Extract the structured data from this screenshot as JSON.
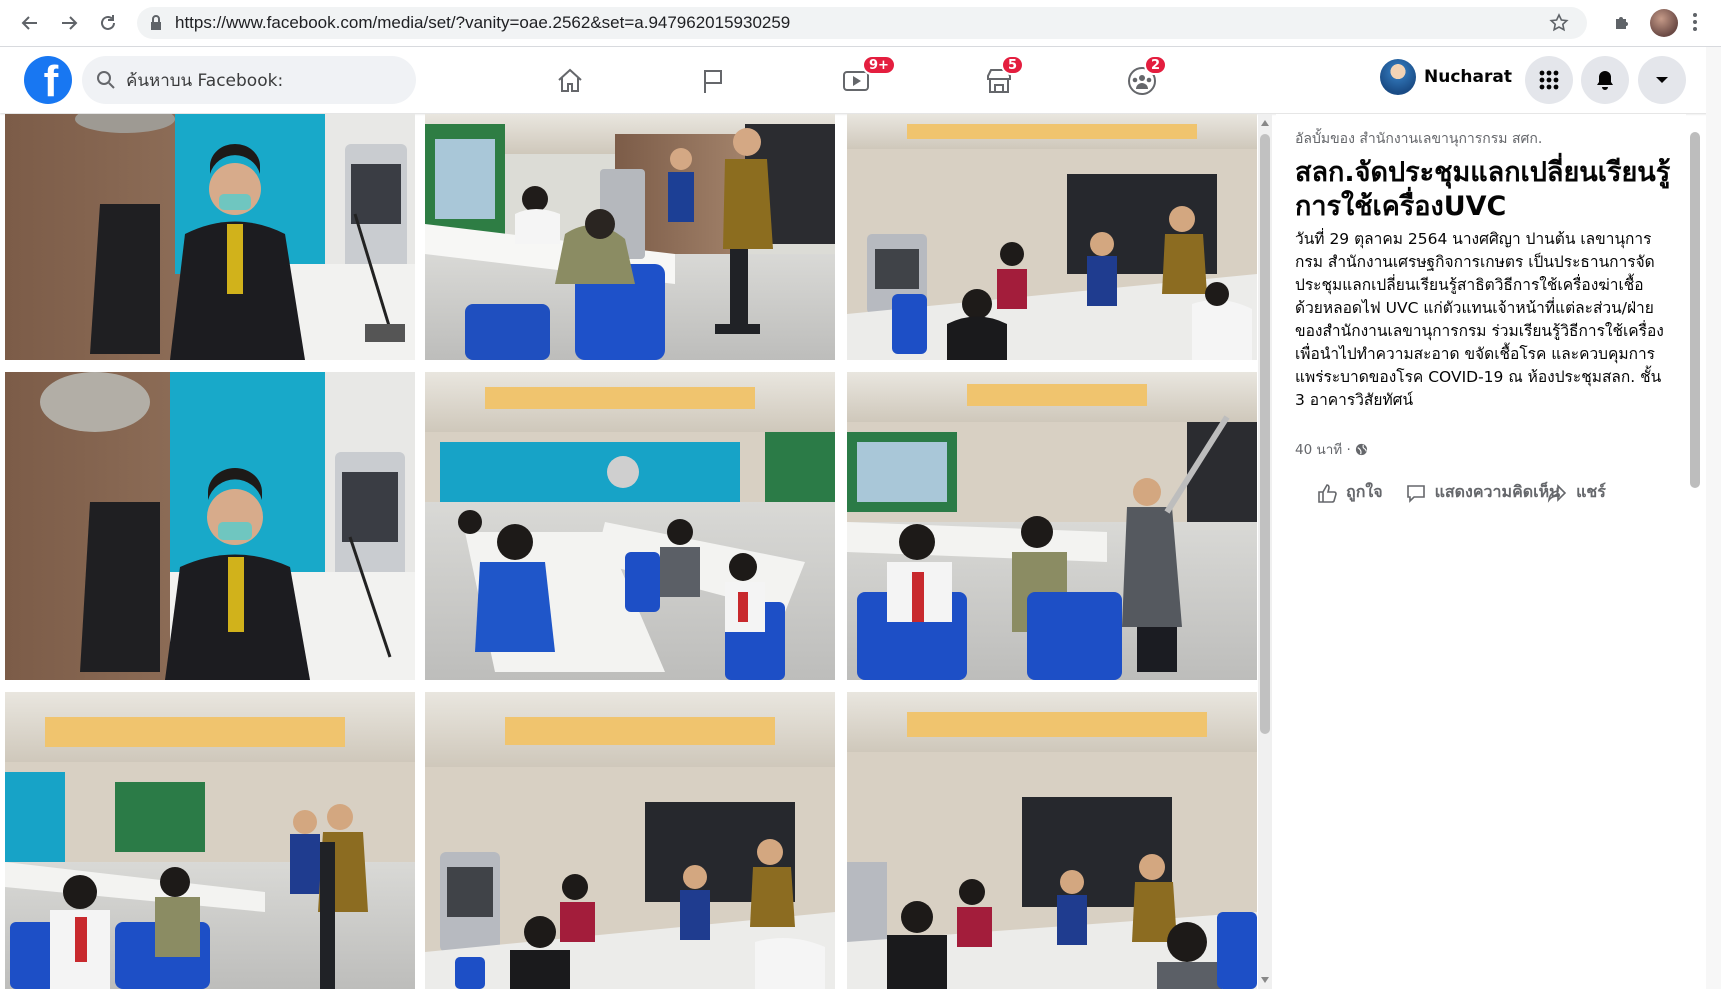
{
  "browser": {
    "url": "https://www.facebook.com/media/set/?vanity=oae.2562&set=a.947962015930259"
  },
  "header": {
    "search_placeholder": "ค้นหาบน Facebook:",
    "badges": {
      "watch": "9+",
      "marketplace": "5",
      "groups": "2"
    },
    "user_name": "Nucharat",
    "brand_color": "#1877f2",
    "badge_color": "#e41e3f"
  },
  "post": {
    "album_owner": "อัลบั้มของ สำนักงานเลขานุการกรม สศก.",
    "title": "สลก.จัดประชุมแลกเปลี่ยนเรียนรู้การใช้เครื่องUVC",
    "body": "วันที่ 29 ตุลาคม 2564 นางศศิญา ปานต้น เลขานุการกรม สำนักงานเศรษฐกิจการเกษตร เป็นประธานการจัดประชุมแลกเปลี่ยนเรียนรู้สาธิตวิธีการใช้เครื่องฆ่าเชื้อด้วยหลอดไฟ UVC แก่ตัวแทนเจ้าหน้าที่แต่ละส่วน/ฝ่ายของสำนักงานเลขานุการกรม ร่วมเรียนรู้วิธีการใช้เครื่องเพื่อนำไปทำความสะอาด ขจัดเชื้อโรค และควบคุมการแพร่ระบาดของโรค COVID-19 ณ ห้องประชุมสลก. ชั้น 3 อาคารวิสัยทัศน์",
    "time": "40 นาที ·",
    "like_label": "ถูกใจ",
    "comment_label": "แสดงความคิดเห็น",
    "share_label": "แชร์"
  },
  "photos": [
    {
      "icon": "photo-director-seated"
    },
    {
      "icon": "photo-uvc-demo-1"
    },
    {
      "icon": "photo-meeting-screen-1"
    },
    {
      "icon": "photo-director-seated-2"
    },
    {
      "icon": "photo-meeting-room-1"
    },
    {
      "icon": "photo-uvc-demo-2"
    },
    {
      "icon": "photo-meeting-room-2"
    },
    {
      "icon": "photo-meeting-screen-2"
    },
    {
      "icon": "photo-meeting-screen-3"
    }
  ]
}
